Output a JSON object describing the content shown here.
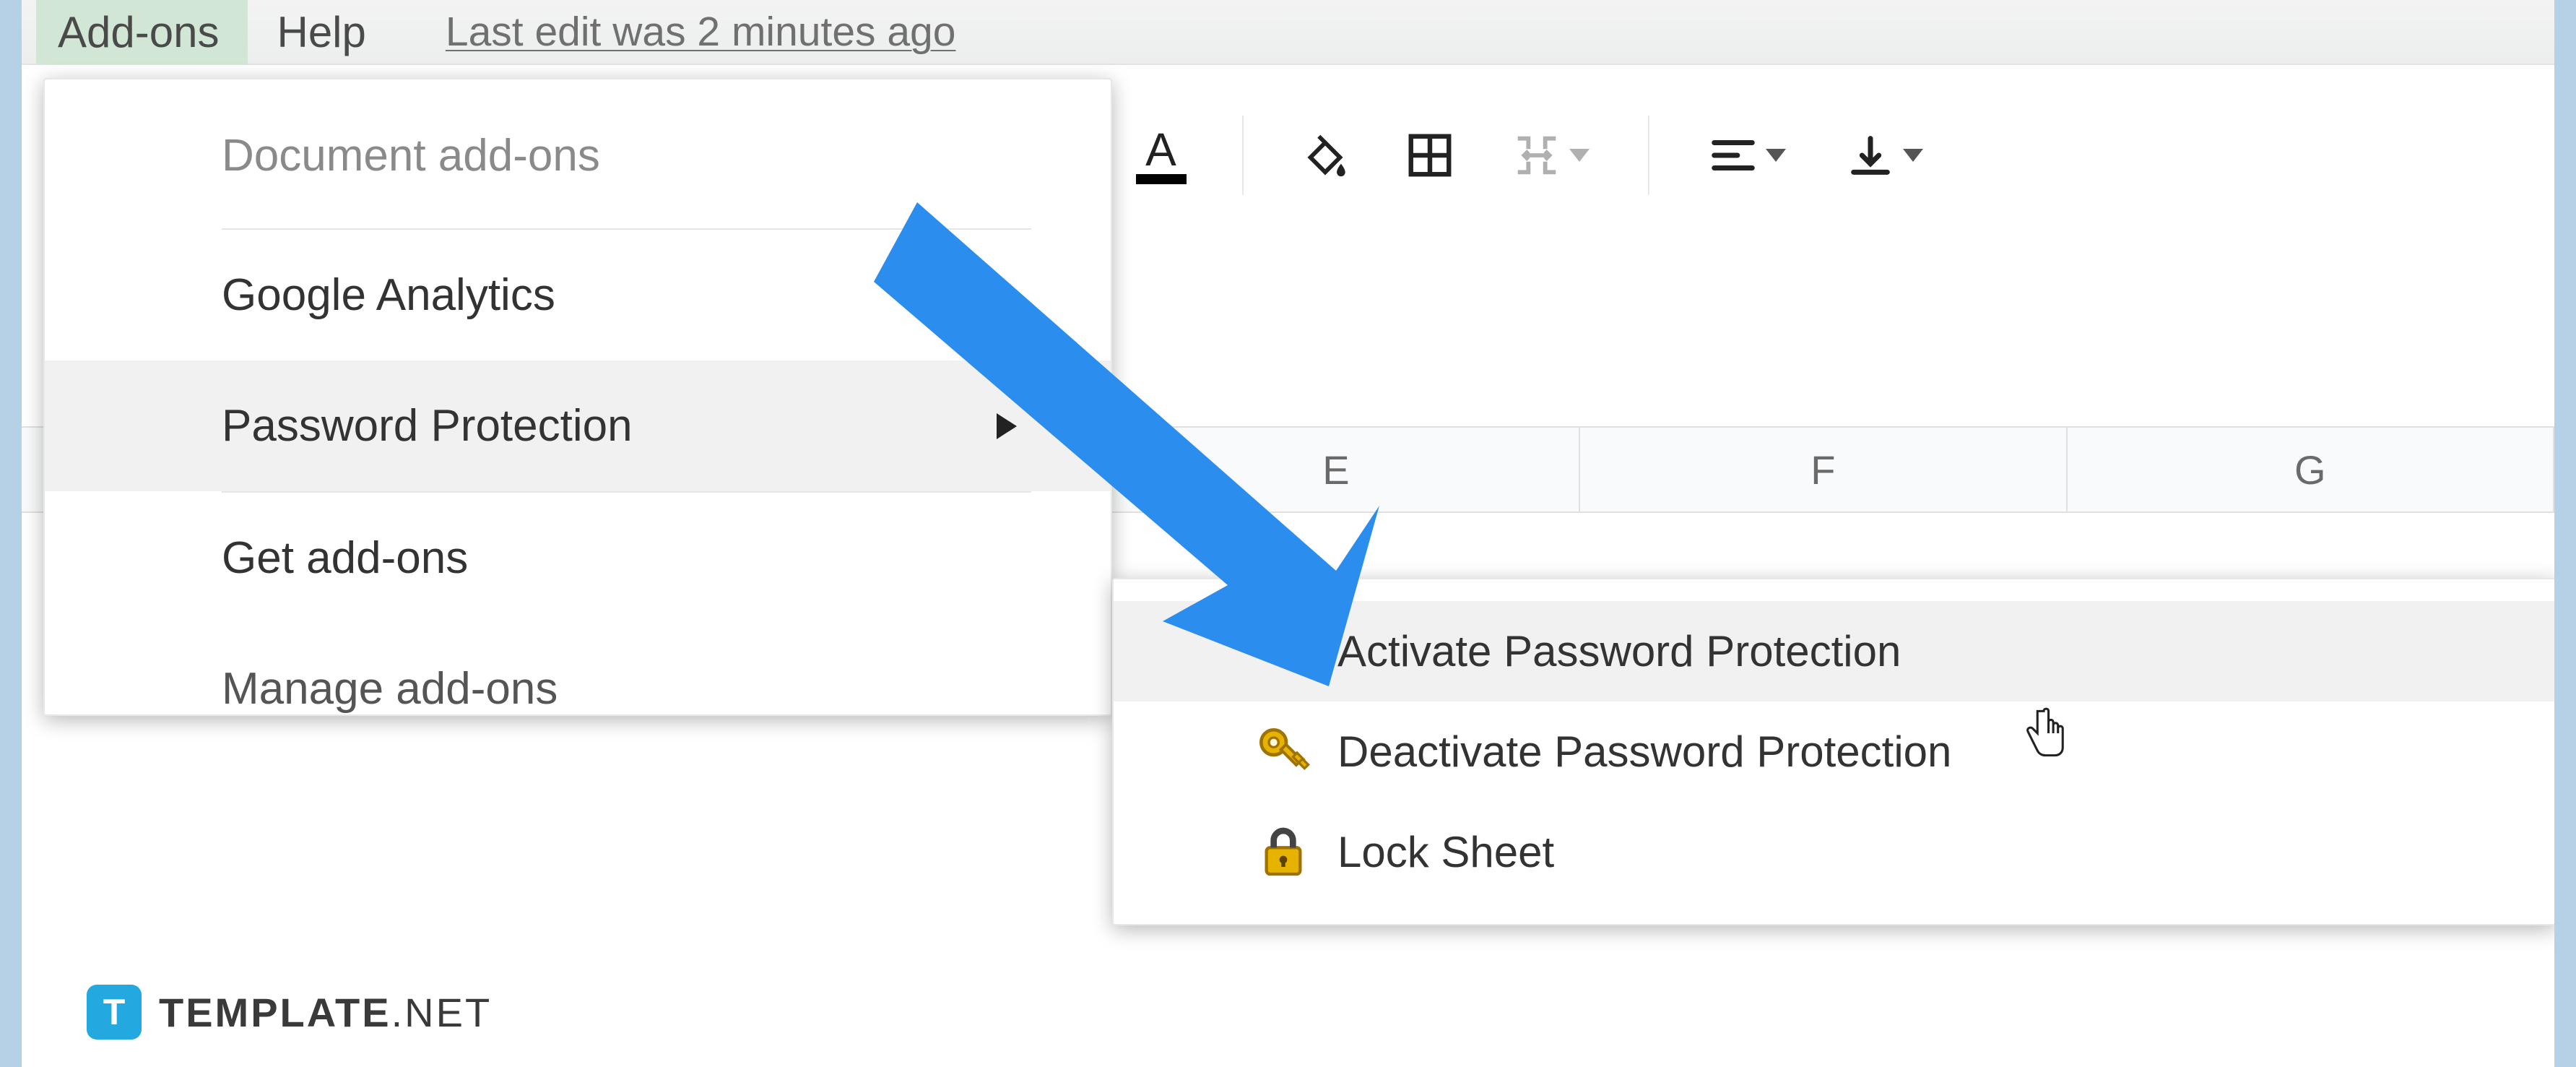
{
  "menubar": {
    "addons": "Add-ons",
    "help": "Help",
    "edit_status": "Last edit was 2 minutes ago"
  },
  "columns": {
    "e": "E",
    "f": "F",
    "g": "G"
  },
  "addons_menu": {
    "section_label": "Document add-ons",
    "items": {
      "google_analytics": "Google Analytics",
      "password_protection": "Password Protection",
      "get_addons": "Get add-ons",
      "manage_addons": "Manage add-ons"
    }
  },
  "submenu": {
    "activate": "Activate Password Protection",
    "deactivate": "Deactivate Password Protection",
    "lock_sheet": "Lock Sheet"
  },
  "watermark": {
    "badge": "T",
    "brand": "TEMPLATE",
    "tld": ".NET"
  }
}
